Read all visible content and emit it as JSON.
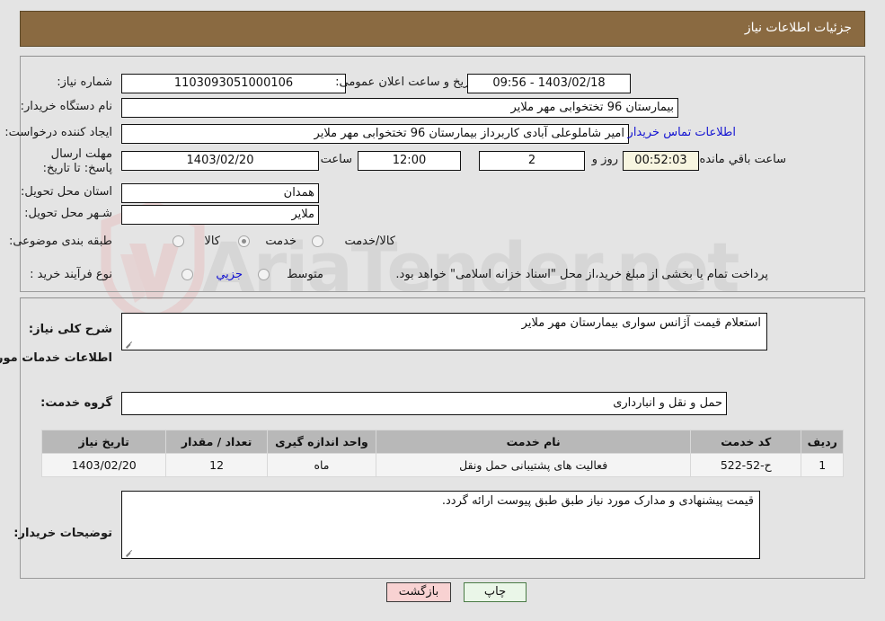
{
  "header": {
    "title": "جزئیات اطلاعات نیاز"
  },
  "top_panel": {
    "need_number_label": "شماره نیاز:",
    "need_number_value": "1103093051000106",
    "announce_label": "تاریخ و ساعت اعلان عمومی:",
    "announce_value": "1403/02/18 - 09:56",
    "buyer_org_label": "نام دستگاه خریدار:",
    "buyer_org_value": "بیمارستان 96 تختخوابی مهر ملایر",
    "creator_label": "ایجاد کننده درخواست:",
    "creator_value": "امیر شاملوعلی آبادی کاربرداز بیمارستان 96 تختخوابی مهر ملایر",
    "contact_link": "اطلاعات تماس خریدار",
    "deadline_label": "مهلت ارسال پاسخ: تا تاریخ:",
    "deadline_date": "1403/02/20",
    "hour_label": "ساعت",
    "deadline_time": "12:00",
    "days_value": "2",
    "days_label": "روز و",
    "countdown_value": "00:52:03",
    "countdown_label": "ساعت باقي مانده",
    "province_label": "استان محل تحویل:",
    "province_value": "همدان",
    "city_label": "شـهر محل تحویل:",
    "city_value": "ملایر",
    "category_label": "طبقه بندی موضوعی:",
    "category_options": [
      {
        "label": "کالا",
        "selected": false
      },
      {
        "label": "خدمت",
        "selected": true
      },
      {
        "label": "کالا/خدمت",
        "selected": false
      }
    ],
    "process_label": "نوع فرآیند خرید :",
    "process_options": [
      {
        "label": "جزیي",
        "selected": false
      },
      {
        "label": "متوسط",
        "selected": false
      }
    ],
    "payment_note": "پرداخت تمام یا بخشی از مبلغ خرید،از محل \"اسناد خزانه اسلامی\" خواهد بود."
  },
  "mid_panel": {
    "summary_label": "شرح کلی نیاز:",
    "summary_value": "استعلام قیمت آژانس سواری بیمارستان مهر ملایر",
    "section_title": "اطلاعات خدمات مورد نیاز",
    "service_group_label": "گروه خدمت:",
    "service_group_value": "حمل و نقل و انبارداری",
    "table": {
      "headers": [
        "ردیف",
        "کد خدمت",
        "نام خدمت",
        "واحد اندازه گیری",
        "تعداد / مقدار",
        "تاریخ نیاز"
      ],
      "rows": [
        {
          "radif": "1",
          "code": "ح-52-522",
          "name": "فعالیت های پشتیبانی حمل ونقل",
          "unit": "ماه",
          "qty": "12",
          "date": "1403/02/20"
        }
      ]
    },
    "notes_label": "توضیحات خریدار:",
    "notes_value": "قیمت پیشنهادی و مدارک مورد نیاز طبق طبق پیوست ارائه گردد."
  },
  "footer": {
    "print_label": "چاپ",
    "back_label": "بازگشت"
  },
  "watermark": {
    "text": "AriaTender.net"
  },
  "colors": {
    "header_bg": "#8a6a41",
    "page_bg": "#e4e4e4",
    "link": "#1414d2",
    "table_header_bg": "#b8b8b8",
    "btn_back_bg": "#f8d2d2",
    "btn_print_bg": "#eaf6e8",
    "countdown_bg": "#f7f5e0"
  }
}
